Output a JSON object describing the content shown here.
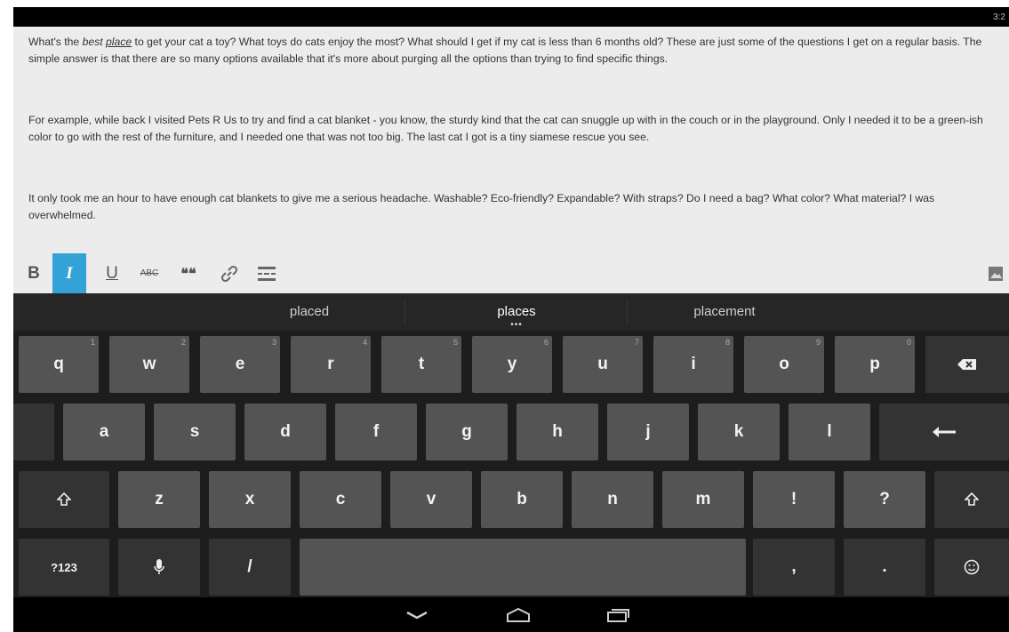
{
  "status": {
    "time": "3:2"
  },
  "editor": {
    "p1_pre": "What's the ",
    "p1_best": "best",
    "p1_space": " ",
    "p1_place": "place",
    "p1_post": " to get your cat a toy? What toys do cats enjoy the most? What should I get if my cat is less than 6 months old? These are just some of the questions I get on a regular basis. The simple answer is that there are so many options available that it's more about purging all the options than trying to find specific things.",
    "p2": "For example, while back I visited Pets R Us to try and find a cat blanket - you know, the sturdy kind that the cat can snuggle up with in the couch or in the playground. Only I needed it to be a green-ish color to go with the rest of the furniture, and I needed one that was not too big. The last cat I got is a tiny siamese rescue you see.",
    "p3": "It only took me an hour to have enough cat blankets to give me a serious headache. Washable? Eco-friendly? Expandable? With straps? Do I need a bag? What color? What material? I was overwhelmed."
  },
  "toolbar": {
    "bold": "B",
    "italic": "I",
    "underline": "U",
    "strike": "ABC",
    "quote": "❝❝"
  },
  "suggestions": [
    "placed",
    "places",
    "placement"
  ],
  "keyboard": {
    "row1": [
      {
        "label": "q",
        "hint": "1"
      },
      {
        "label": "w",
        "hint": "2"
      },
      {
        "label": "e",
        "hint": "3"
      },
      {
        "label": "r",
        "hint": "4"
      },
      {
        "label": "t",
        "hint": "5"
      },
      {
        "label": "y",
        "hint": "6"
      },
      {
        "label": "u",
        "hint": "7"
      },
      {
        "label": "i",
        "hint": "8"
      },
      {
        "label": "o",
        "hint": "9"
      },
      {
        "label": "p",
        "hint": "0"
      }
    ],
    "row2": [
      "a",
      "s",
      "d",
      "f",
      "g",
      "h",
      "j",
      "k",
      "l"
    ],
    "row3": [
      "z",
      "x",
      "c",
      "v",
      "b",
      "n",
      "m",
      "!",
      "?"
    ],
    "symbols": "?123",
    "slash": "/",
    "comma": ",",
    "period": "."
  }
}
